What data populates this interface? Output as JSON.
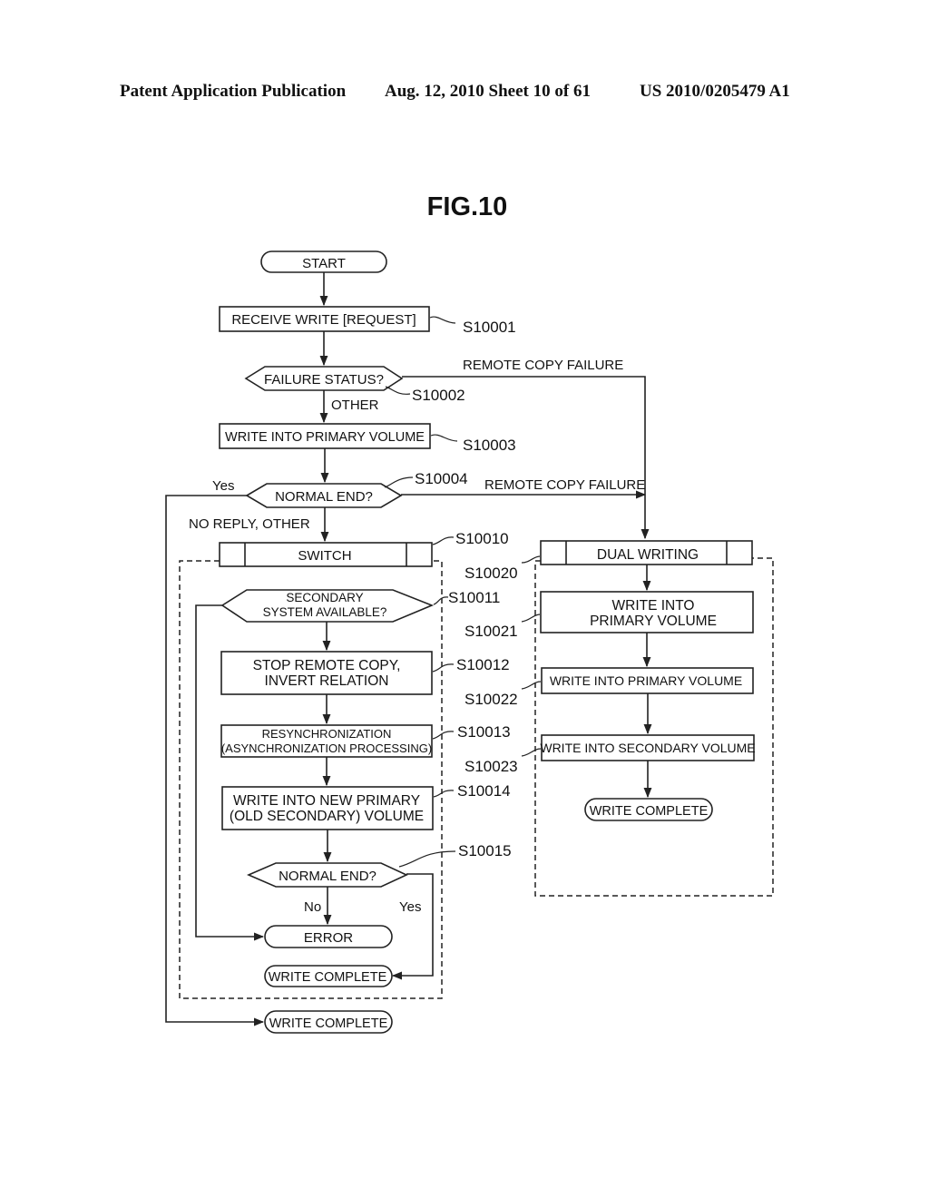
{
  "header": {
    "publication": "Patent Application Publication",
    "date_sheet": "Aug. 12, 2010  Sheet 10 of 61",
    "patent_number": "US 2010/0205479 A1"
  },
  "figure": {
    "title": "FIG.10"
  },
  "nodes": {
    "start": "START",
    "receive": "RECEIVE WRITE [REQUEST]",
    "failure_status": "FAILURE STATUS?",
    "write_primary": "WRITE INTO PRIMARY VOLUME",
    "normal_end_1": "NORMAL END?",
    "switch": "SWITCH",
    "secondary_available_1": "SECONDARY",
    "secondary_available_2": "SYSTEM AVAILABLE?",
    "stop_remote_1": "STOP REMOTE COPY,",
    "stop_remote_2": "INVERT RELATION",
    "resync_1": "RESYNCHRONIZATION",
    "resync_2": "(ASYNCHRONIZATION PROCESSING)",
    "write_new_primary_1": "WRITE INTO NEW PRIMARY",
    "write_new_primary_2": "(OLD SECONDARY) VOLUME",
    "normal_end_2": "NORMAL END?",
    "error": "ERROR",
    "write_complete_switch": "WRITE COMPLETE",
    "write_complete_main": "WRITE COMPLETE",
    "dual_writing": "DUAL WRITING",
    "dual_write_primary_1": "WRITE INTO",
    "dual_write_primary_2": "PRIMARY VOLUME",
    "dual_write_primary_b": "WRITE INTO PRIMARY VOLUME",
    "dual_write_secondary": "WRITE INTO SECONDARY VOLUME",
    "write_complete_dual": "WRITE COMPLETE"
  },
  "edge_labels": {
    "remote_copy_failure_1": "REMOTE COPY FAILURE",
    "other": "OTHER",
    "yes_1": "Yes",
    "remote_copy_failure_2": "REMOTE COPY FAILURE",
    "no_reply_other": "NO REPLY, OTHER",
    "no": "No",
    "yes_2": "Yes"
  },
  "step_labels": {
    "s10001": "S10001",
    "s10002": "S10002",
    "s10003": "S10003",
    "s10004": "S10004",
    "s10010": "S10010",
    "s10011": "S10011",
    "s10012": "S10012",
    "s10013": "S10013",
    "s10014": "S10014",
    "s10015": "S10015",
    "s10020": "S10020",
    "s10021": "S10021",
    "s10022": "S10022",
    "s10023": "S10023"
  }
}
